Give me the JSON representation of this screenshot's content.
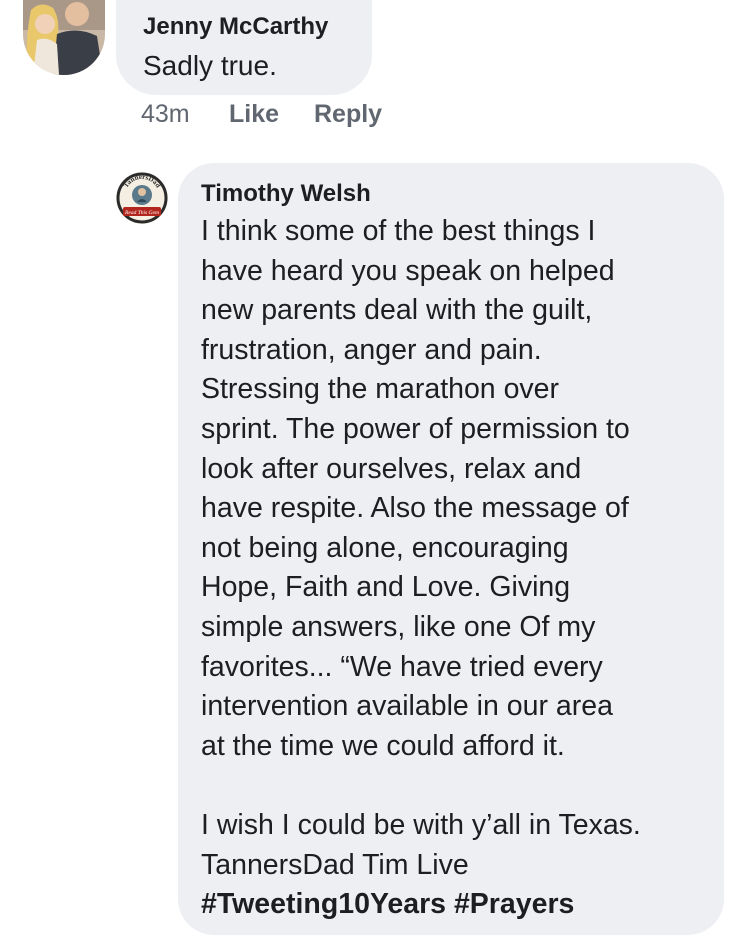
{
  "comments": [
    {
      "author": "Jenny McCarthy",
      "text": "Sadly true.",
      "time": "43m",
      "like_label": "Like",
      "reply_label": "Reply"
    },
    {
      "author": "Timothy Welsh",
      "lines": [
        "I think some of the best things I",
        "have heard you speak on helped",
        "new parents deal with the guilt,",
        "frustration, anger and pain.",
        "Stressing the marathon over",
        "sprint. The power of permission to",
        "look after ourselves, relax and",
        "have respite. Also the message of",
        "not being alone, encouraging",
        "Hope, Faith and Love. Giving",
        "simple answers, like one Of my",
        "favorites... “We have tried every",
        "intervention available in our area",
        "at the time we could afford it.",
        "",
        "I wish I could be with y’all in Texas.",
        "TannersDad Tim Live"
      ],
      "hashtags": "#Tweeting10Years #Prayers",
      "avatar_badge_top": "TannersDad",
      "avatar_badge_bottom": "Read This Gem"
    }
  ],
  "colors": {
    "bubble": "#eeeff2",
    "meta_text": "#606770",
    "text": "#1c1e21",
    "badge_red": "#b3261e"
  }
}
